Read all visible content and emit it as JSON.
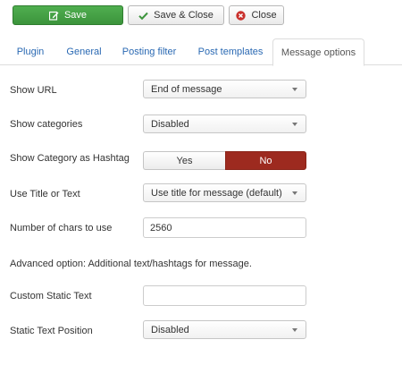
{
  "toolbar": {
    "save_label": "Save",
    "save_close_label": "Save & Close",
    "close_label": "Close"
  },
  "tabs": [
    {
      "label": "Plugin",
      "active": false
    },
    {
      "label": "General",
      "active": false
    },
    {
      "label": "Posting filter",
      "active": false
    },
    {
      "label": "Post templates",
      "active": false
    },
    {
      "label": "Message options",
      "active": true
    }
  ],
  "form": {
    "show_url": {
      "label": "Show URL",
      "value": "End of message"
    },
    "show_categories": {
      "label": "Show categories",
      "value": "Disabled"
    },
    "category_hashtag": {
      "label": "Show Category as Hashtag",
      "yes": "Yes",
      "no": "No",
      "selected": "No"
    },
    "title_or_text": {
      "label": "Use Title or Text",
      "value": "Use title for message (default)"
    },
    "num_chars": {
      "label": "Number of chars to use",
      "value": "2560"
    },
    "advanced_note": "Advanced option: Additional text/hashtags for message.",
    "custom_static_text": {
      "label": "Custom Static Text",
      "value": ""
    },
    "static_text_position": {
      "label": "Static Text Position",
      "value": "Disabled"
    }
  },
  "colors": {
    "save_green": "#46a546",
    "no_active_red": "#9d2a1f",
    "tab_link_blue": "#2a69b3",
    "close_icon_red": "#c9302c"
  }
}
